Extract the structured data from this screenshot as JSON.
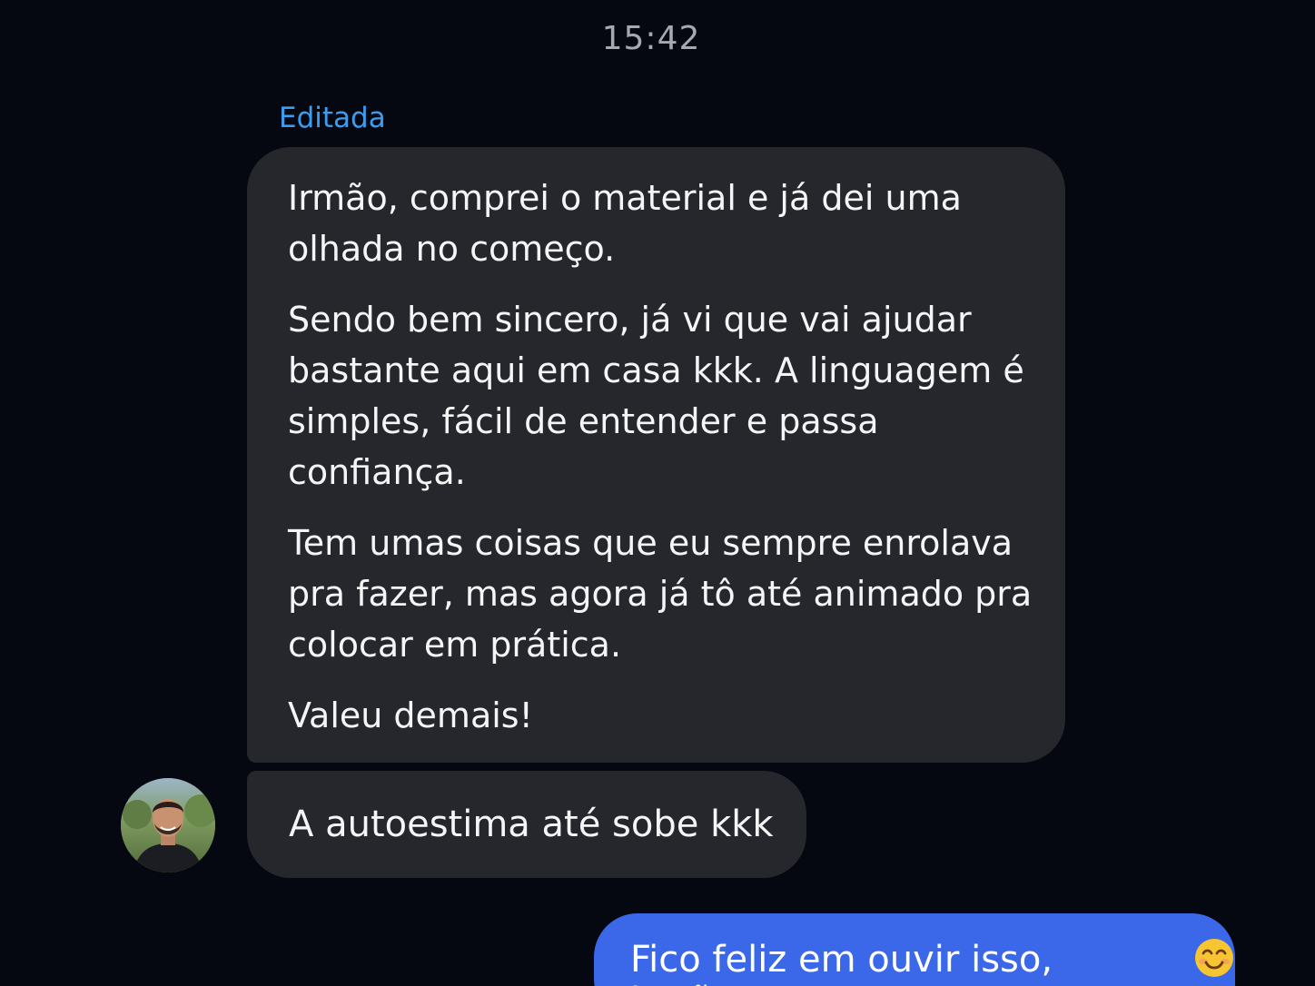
{
  "header": {
    "time": "15:42"
  },
  "conversation": {
    "edited_label": "Editada",
    "incoming": {
      "first_message_paragraphs": [
        "Irmão, comprei o material e já dei uma olhada no começo.",
        "Sendo bem sincero, já vi que vai ajudar bastante aqui em casa kkk. A linguagem é simples, fácil de entender e passa confiança.",
        "Tem umas coisas que eu sempre enrolava pra fazer, mas agora já tô até animado pra colocar em prática.",
        "Valeu demais!"
      ],
      "second_message": "A autoestima até sobe kkk",
      "avatar_icon": "contact-avatar"
    },
    "outgoing": {
      "message": "Fico feliz em ouvir isso, irmão!",
      "emoji_icon": "smiling-face-emoji"
    }
  },
  "colors": {
    "background": "#050811",
    "incoming_bubble": "#25272c",
    "outgoing_bubble": "#3a68e8",
    "edited_label": "#3b9df0",
    "timestamp": "#a6a9b0"
  }
}
